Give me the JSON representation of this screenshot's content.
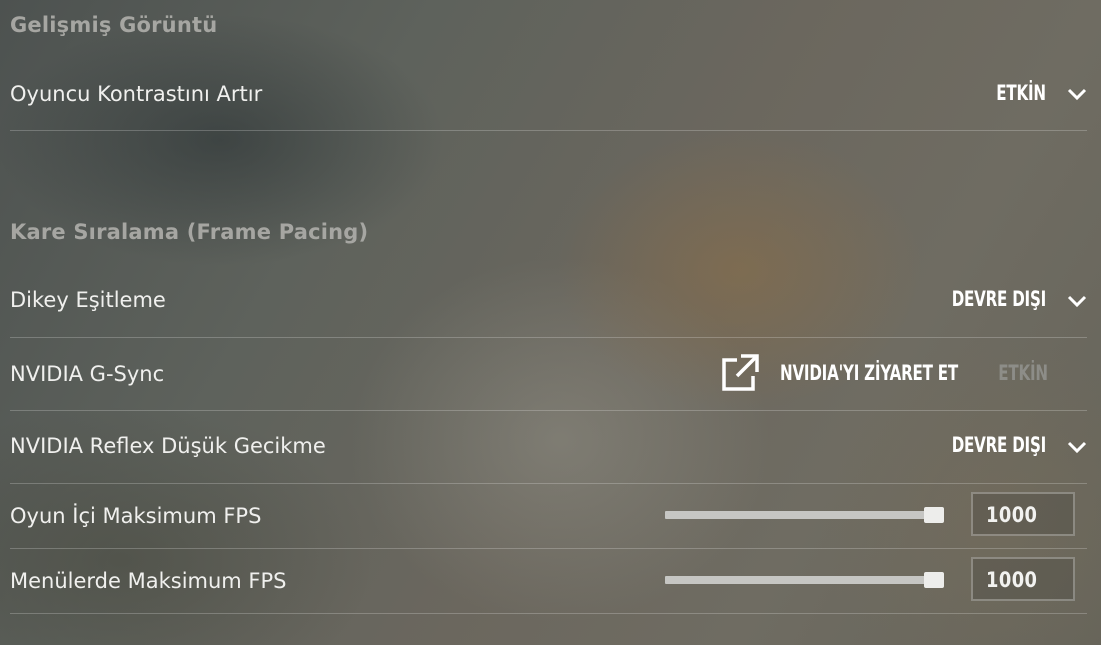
{
  "sections": {
    "advanced_display": {
      "title": "Gelişmiş Görüntü"
    },
    "frame_pacing": {
      "title": "Kare Sıralama (Frame Pacing)"
    }
  },
  "settings": {
    "player_contrast": {
      "label": "Oyuncu Kontrastını Artır",
      "value": "ETKİN",
      "icon": "chevron-down-icon"
    },
    "vsync": {
      "label": "Dikey Eşitleme",
      "value": "DEVRE DIŞI",
      "icon": "chevron-down-icon"
    },
    "gsync": {
      "label": "NVIDIA G-Sync",
      "link_label": "NVIDIA'YI ZİYARET ET",
      "link_icon": "external-link-icon",
      "value": "ETKİN",
      "value_state": "disabled"
    },
    "reflex": {
      "label": "NVIDIA Reflex Düşük Gecikme",
      "value": "DEVRE DIŞI",
      "icon": "chevron-down-icon"
    },
    "max_fps_game": {
      "label": "Oyun İçi Maksimum FPS",
      "value": "1000",
      "slider_fraction": 1.0
    },
    "max_fps_menu": {
      "label": "Menülerde Maksimum FPS",
      "value": "1000",
      "slider_fraction": 1.0
    }
  },
  "colors": {
    "section_title": "#a6a6a2",
    "label": "#f0f0ee",
    "value": "#ffffff",
    "disabled_value": "#8d8d88"
  }
}
